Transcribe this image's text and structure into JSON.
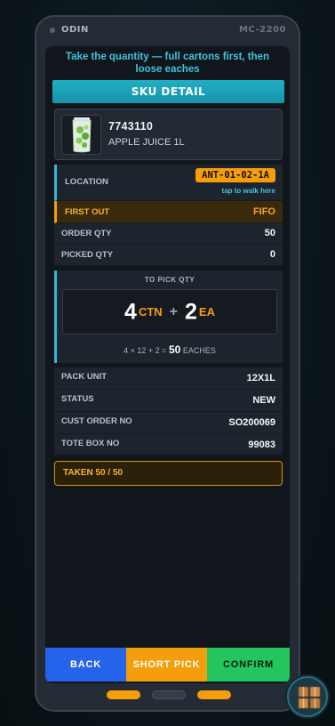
{
  "device": {
    "brand": "ODIN",
    "model": "MC-2200"
  },
  "instruction": "Take the quantity — full cartons first, then loose eaches",
  "sku_detail_label": "SKU DETAIL",
  "product": {
    "sku": "7743110",
    "name": "APPLE JUICE 1L",
    "image_icon": "juice-bottle-icon"
  },
  "location": {
    "label": "LOCATION",
    "code": "ANT-01-02-1A",
    "hint": "tap to walk here"
  },
  "first_out": {
    "label": "FIRST OUT",
    "value": "FIFO"
  },
  "order_qty": {
    "label": "ORDER QTY",
    "value": "50"
  },
  "picked_qty": {
    "label": "PICKED QTY",
    "value": "0"
  },
  "to_pick": {
    "title": "TO PICK QTY",
    "cartons": "4",
    "carton_unit": "CTN",
    "plus": "+",
    "eaches": "2",
    "each_unit": "EA",
    "formula": "4 × 12 + 2 =",
    "total": "50",
    "total_unit": "EACHES"
  },
  "details": [
    {
      "label": "PACK UNIT",
      "value": "12X1L"
    },
    {
      "label": "STATUS",
      "value": "NEW"
    },
    {
      "label": "CUST ORDER NO",
      "value": "SO200069"
    },
    {
      "label": "TOTE BOX NO",
      "value": "99083"
    }
  ],
  "taken": "TAKEN 50 / 50",
  "actions": {
    "back": "BACK",
    "short_pick": "SHORT PICK",
    "confirm": "CONFIRM"
  },
  "colors": {
    "accent": "#2fb9d0",
    "warning": "#f59e0b",
    "back": "#2563eb",
    "confirm": "#22c55e"
  },
  "fab_icon": "boxes-icon"
}
